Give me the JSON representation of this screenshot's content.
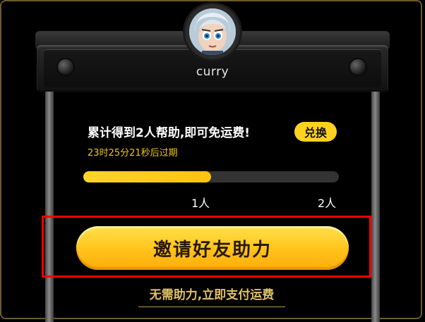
{
  "user": {
    "name": "curry"
  },
  "promo": {
    "headline": "累计得到2人帮助,即可免运费!",
    "exchange_label": "兑换",
    "countdown": "23时25分21秒后过期"
  },
  "progress": {
    "fraction": 0.5,
    "milestone_1": "1人",
    "milestone_2": "2人"
  },
  "actions": {
    "invite_label": "邀请好友助力",
    "pay_label": "无需助力,立即支付运费"
  },
  "colors": {
    "accent_yellow": "#ffc21a",
    "highlight_red": "#ff0000",
    "link_gold": "#e0c06a"
  }
}
